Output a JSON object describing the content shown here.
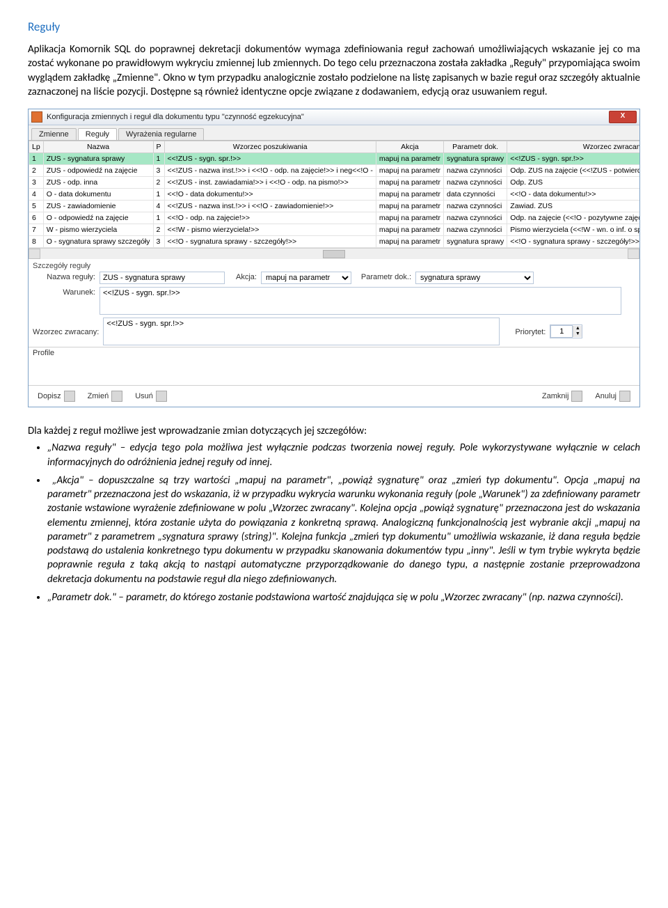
{
  "heading": "Reguły",
  "intro": "Aplikacja Komornik SQL do poprawnej dekretacji dokumentów wymaga zdefiniowania reguł zachowań umożliwiających wskazanie jej co ma zostać wykonane po prawidłowym wykryciu zmiennej lub zmiennych. Do tego celu przeznaczona została zakładka „Reguły\" przypomiająca swoim wyglądem zakładkę „Zmienne\". Okno w tym przypadku analogicznie zostało podzielone na listę zapisanych w bazie reguł oraz szczegóły aktualnie zaznaczonej na liście pozycji. Dostępne są również identyczne opcje związane z dodawaniem, edycją oraz usuwaniem reguł.",
  "window": {
    "title": "Konfiguracja zmiennych i reguł dla dokumentu typu \"czynność egzekucyjna\"",
    "tabs": [
      "Zmienne",
      "Reguły",
      "Wyrażenia regularne"
    ],
    "active_tab": 1,
    "columns": [
      "Lp",
      "Nazwa",
      "P",
      "Wzorzec poszukiwania",
      "Akcja",
      "Parametr dok.",
      "Wzorzec zwracany"
    ],
    "rows": [
      {
        "lp": "1",
        "nazwa": "ZUS - sygnatura sprawy",
        "p": "1",
        "wzorzec": "<<!ZUS - sygn. spr.!>>",
        "akcja": "mapuj na parametr",
        "param": "sygnatura sprawy",
        "zwr": "<<!ZUS - sygn. spr.!>>"
      },
      {
        "lp": "2",
        "nazwa": "ZUS - odpowiedź na zajęcie",
        "p": "3",
        "wzorzec": "<<!ZUS - nazwa inst.!>>  i  <<!O - odp. na zajęcie!>> i neg<<!O -",
        "akcja": "mapuj na parametr",
        "param": "nazwa czynności",
        "zwr": "Odp. ZUS na zajęcie (<<!ZUS - potwierdzenie zajęcia!>><<!O -"
      },
      {
        "lp": "3",
        "nazwa": "ZUS - odp. inna",
        "p": "2",
        "wzorzec": "<<!ZUS - inst. zawiadamia!>> i <<!O - odp. na pismo!>>",
        "akcja": "mapuj na parametr",
        "param": "nazwa czynności",
        "zwr": "Odp. ZUS"
      },
      {
        "lp": "4",
        "nazwa": "O - data dokumentu",
        "p": "1",
        "wzorzec": "<<!O - data dokumentu!>>",
        "akcja": "mapuj na parametr",
        "param": "data czynności",
        "zwr": "<<!O - data dokumentu!>>"
      },
      {
        "lp": "5",
        "nazwa": "ZUS - zawiadomienie",
        "p": "4",
        "wzorzec": "<<!ZUS - nazwa inst.!>>  i  <<!O - zawiadomienie!>>",
        "akcja": "mapuj na parametr",
        "param": "nazwa czynności",
        "zwr": "Zawiad. ZUS"
      },
      {
        "lp": "6",
        "nazwa": "O - odpowiedź na zajęcie",
        "p": "1",
        "wzorzec": "<<!O - odp. na zajęcie!>>",
        "akcja": "mapuj na parametr",
        "param": "nazwa czynności",
        "zwr": "Odp. na zajęcie (<<!O - pozytywne zajęcie!>><<!O - negatywne"
      },
      {
        "lp": "7",
        "nazwa": "W - pismo wierzyciela",
        "p": "2",
        "wzorzec": "<<!W - pismo wierzyciela!>>",
        "akcja": "mapuj na parametr",
        "param": "nazwa czynności",
        "zwr": "Pismo wierzyciela (<<!W - wn. o inf. o sprawie!>><<!W - wn. o z"
      },
      {
        "lp": "8",
        "nazwa": "O - sygnatura sprawy szczegóły",
        "p": "3",
        "wzorzec": "<<!O - sygnatura sprawy - szczegóły!>>",
        "akcja": "mapuj na parametr",
        "param": "sygnatura sprawy",
        "zwr": "<<!O - sygnatura sprawy - szczegóły!>>"
      }
    ],
    "details": {
      "legend": "Szczegóły reguły",
      "name_label": "Nazwa reguły:",
      "name_value": "ZUS - sygnatura sprawy",
      "action_label": "Akcja:",
      "action_value": "mapuj na parametr",
      "param_label": "Parametr dok.:",
      "param_value": "sygnatura sprawy",
      "warunek_label": "Warunek:",
      "warunek_value": "<<!ZUS - sygn. spr.!>>",
      "wzorzec_label": "Wzorzec zwracany:",
      "wzorzec_value": "<<!ZUS - sygn. spr.!>>",
      "priority_label": "Priorytet:",
      "priority_value": "1"
    },
    "profile_label": "Profile",
    "buttons": {
      "dopisz": "Dopisz",
      "zmien": "Zmień",
      "usun": "Usuń",
      "zamknij": "Zamknij",
      "anuluj": "Anuluj"
    }
  },
  "post_intro": "Dla każdej z reguł możliwe jest wprowadzanie zmian dotyczących jej szczegółów:",
  "bullets": {
    "b1": "„Nazwa reguły\" – edycja tego pola możliwa jest wyłącznie podczas tworzenia nowej reguły. Pole wykorzystywane wyłącznie w celach informacyjnych do odróżnienia jednej reguły od innej.",
    "b2": " „Akcja\" – dopuszczalne są trzy wartości „mapuj na parametr\", „powiąż sygnaturę\" oraz „zmień typ dokumentu\". Opcja „mapuj na parametr\" przeznaczona jest do wskazania, iż w przypadku wykrycia warunku wykonania reguły (pole „Warunek\") za zdefiniowany parametr zostanie wstawione wyrażenie zdefiniowane w polu „Wzorzec zwracany\". Kolejna opcja „powiąż sygnaturę\" przeznaczona jest do wskazania elementu zmiennej, która zostanie użyta do powiązania z konkretną sprawą. Analogiczną funkcjonalnością jest wybranie akcji „mapuj na parametr\" z parametrem „sygnatura sprawy (string)\". Kolejna funkcja „zmień typ dokumentu\" umożliwia wskazanie, iż dana reguła będzie podstawą do ustalenia konkretnego typu dokumentu w przypadku skanowania dokumentów typu „inny\". Jeśli w tym trybie wykryta będzie poprawnie reguła z taką akcją to nastąpi automatyczne przyporządkowanie do danego typu, a następnie zostanie przeprowadzona dekretacja dokumentu na podstawie reguł dla niego zdefiniowanych.",
    "b3": "„Parametr dok.\" – parametr, do którego zostanie podstawiona wartość znajdująca się w polu „Wzorzec zwracany\" (np. nazwa czynności)."
  }
}
